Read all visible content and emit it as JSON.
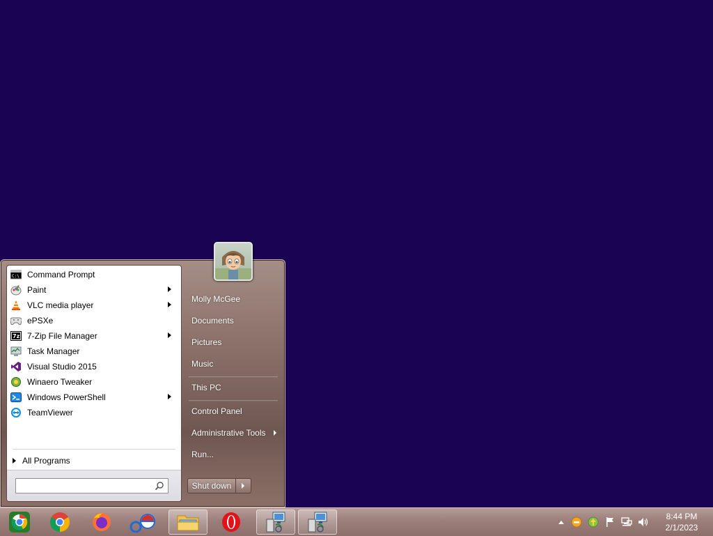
{
  "start_menu": {
    "pinned_programs": [
      {
        "label": "Command Prompt",
        "icon": "command-prompt-icon",
        "has_submenu": false
      },
      {
        "label": "Paint",
        "icon": "paint-icon",
        "has_submenu": true
      },
      {
        "label": "VLC media player",
        "icon": "vlc-icon",
        "has_submenu": true
      },
      {
        "label": "ePSXe",
        "icon": "gamepad-icon",
        "has_submenu": false
      },
      {
        "label": "7-Zip File Manager",
        "icon": "7zip-icon",
        "has_submenu": true
      },
      {
        "label": "Task Manager",
        "icon": "task-manager-icon",
        "has_submenu": false
      },
      {
        "label": "Visual Studio 2015",
        "icon": "visual-studio-icon",
        "has_submenu": false
      },
      {
        "label": "Winaero Tweaker",
        "icon": "winaero-tweaker-icon",
        "has_submenu": false
      },
      {
        "label": "Windows PowerShell",
        "icon": "powershell-icon",
        "has_submenu": true
      },
      {
        "label": "TeamViewer",
        "icon": "teamviewer-icon",
        "has_submenu": false
      }
    ],
    "all_programs_label": "All Programs",
    "search": {
      "value": "",
      "placeholder": ""
    },
    "right_items": [
      {
        "label": "Molly McGee",
        "has_submenu": false
      },
      {
        "label": "Documents",
        "has_submenu": false
      },
      {
        "label": "Pictures",
        "has_submenu": false
      },
      {
        "label": "Music",
        "has_submenu": false
      },
      {
        "label": "This PC",
        "has_submenu": false
      },
      {
        "label": "Control Panel",
        "has_submenu": false
      },
      {
        "label": "Administrative Tools",
        "has_submenu": true
      },
      {
        "label": "Run...",
        "has_submenu": false
      }
    ],
    "shutdown_label": "Shut down"
  },
  "taskbar": {
    "apps": [
      {
        "icon": "start-orb-icon",
        "active": false
      },
      {
        "icon": "chrome-icon",
        "active": false
      },
      {
        "icon": "firefox-icon",
        "active": false
      },
      {
        "icon": "opera-gx-icon",
        "active": false
      },
      {
        "icon": "file-explorer-icon",
        "active": true
      },
      {
        "icon": "opera-icon",
        "active": false
      },
      {
        "icon": "remote-desktop-icon",
        "active": true
      },
      {
        "icon": "remote-desktop-icon",
        "active": true
      }
    ],
    "clock": {
      "time": "8:44 PM",
      "date": "2/1/2023"
    }
  },
  "colors": {
    "desktop": "#1b0354",
    "menu_frame": "#8b7069",
    "taskbar": "#9c7f7b"
  }
}
